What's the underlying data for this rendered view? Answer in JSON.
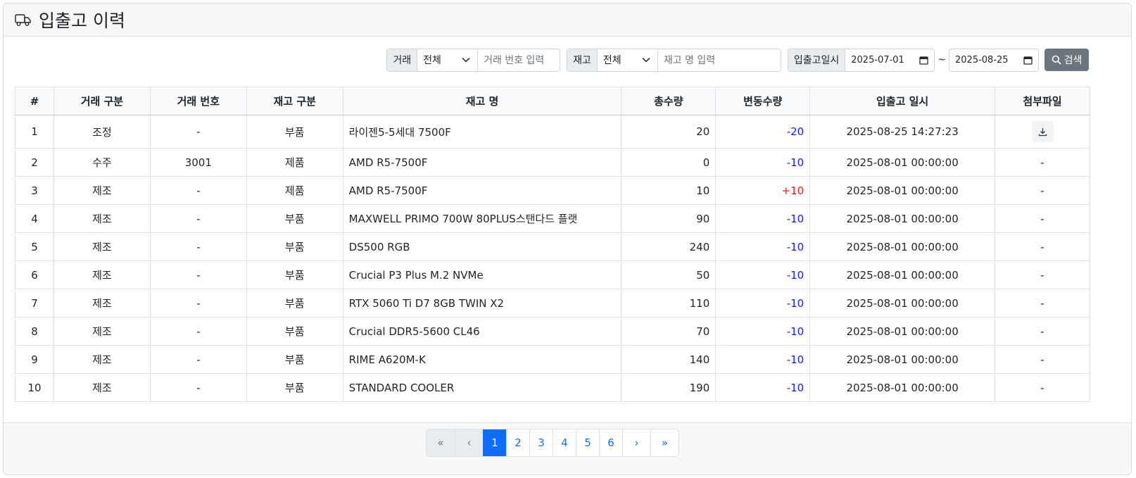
{
  "header": {
    "title": "입출고 이력",
    "icon": "truck-icon"
  },
  "toolbar": {
    "trade_label": "거래",
    "trade_select": "전체",
    "trade_no_placeholder": "거래 번호 입력",
    "stock_label": "재고",
    "stock_select": "전체",
    "stock_name_placeholder": "재고 명 입력",
    "date_label": "입출고일시",
    "date_from": "2025-07-01",
    "date_to": "2025-08-25",
    "tilde": "~",
    "search_label": "검색"
  },
  "table": {
    "columns": [
      "#",
      "거래 구분",
      "거래 번호",
      "재고 구분",
      "재고 명",
      "총수량",
      "변동수량",
      "입출고 일시",
      "첨부파일"
    ],
    "rows": [
      {
        "no": "1",
        "trade_type": "조정",
        "trade_no": "-",
        "stock_type": "부품",
        "name": "라이젠5-5세대 7500F",
        "total": "20",
        "change": "-20",
        "datetime": "2025-08-25 14:27:23",
        "attach": "download"
      },
      {
        "no": "2",
        "trade_type": "수주",
        "trade_no": "3001",
        "stock_type": "제품",
        "name": "AMD R5-7500F",
        "total": "0",
        "change": "-10",
        "datetime": "2025-08-01 00:00:00",
        "attach": "-"
      },
      {
        "no": "3",
        "trade_type": "제조",
        "trade_no": "-",
        "stock_type": "제품",
        "name": "AMD R5-7500F",
        "total": "10",
        "change": "+10",
        "datetime": "2025-08-01 00:00:00",
        "attach": "-"
      },
      {
        "no": "4",
        "trade_type": "제조",
        "trade_no": "-",
        "stock_type": "부품",
        "name": "MAXWELL PRIMO 700W 80PLUS스탠다드 플랫",
        "total": "90",
        "change": "-10",
        "datetime": "2025-08-01 00:00:00",
        "attach": "-"
      },
      {
        "no": "5",
        "trade_type": "제조",
        "trade_no": "-",
        "stock_type": "부품",
        "name": "DS500 RGB",
        "total": "240",
        "change": "-10",
        "datetime": "2025-08-01 00:00:00",
        "attach": "-"
      },
      {
        "no": "6",
        "trade_type": "제조",
        "trade_no": "-",
        "stock_type": "부품",
        "name": "Crucial P3 Plus M.2 NVMe",
        "total": "50",
        "change": "-10",
        "datetime": "2025-08-01 00:00:00",
        "attach": "-"
      },
      {
        "no": "7",
        "trade_type": "제조",
        "trade_no": "-",
        "stock_type": "부품",
        "name": "RTX 5060 Ti D7 8GB TWIN X2",
        "total": "110",
        "change": "-10",
        "datetime": "2025-08-01 00:00:00",
        "attach": "-"
      },
      {
        "no": "8",
        "trade_type": "제조",
        "trade_no": "-",
        "stock_type": "부품",
        "name": "Crucial DDR5-5600 CL46",
        "total": "70",
        "change": "-10",
        "datetime": "2025-08-01 00:00:00",
        "attach": "-"
      },
      {
        "no": "9",
        "trade_type": "제조",
        "trade_no": "-",
        "stock_type": "부품",
        "name": "RIME A620M-K",
        "total": "140",
        "change": "-10",
        "datetime": "2025-08-01 00:00:00",
        "attach": "-"
      },
      {
        "no": "10",
        "trade_type": "제조",
        "trade_no": "-",
        "stock_type": "부품",
        "name": "STANDARD COOLER",
        "total": "190",
        "change": "-10",
        "datetime": "2025-08-01 00:00:00",
        "attach": "-"
      }
    ]
  },
  "pagination": {
    "first": "«",
    "prev": "‹",
    "next": "›",
    "last": "»",
    "pages": [
      "1",
      "2",
      "3",
      "4",
      "5",
      "6"
    ],
    "active": "1"
  },
  "colors": {
    "negative": "#1a1aff",
    "positive": "#e01e1e",
    "primary": "#0d6efd",
    "secondary": "#6c757d"
  }
}
